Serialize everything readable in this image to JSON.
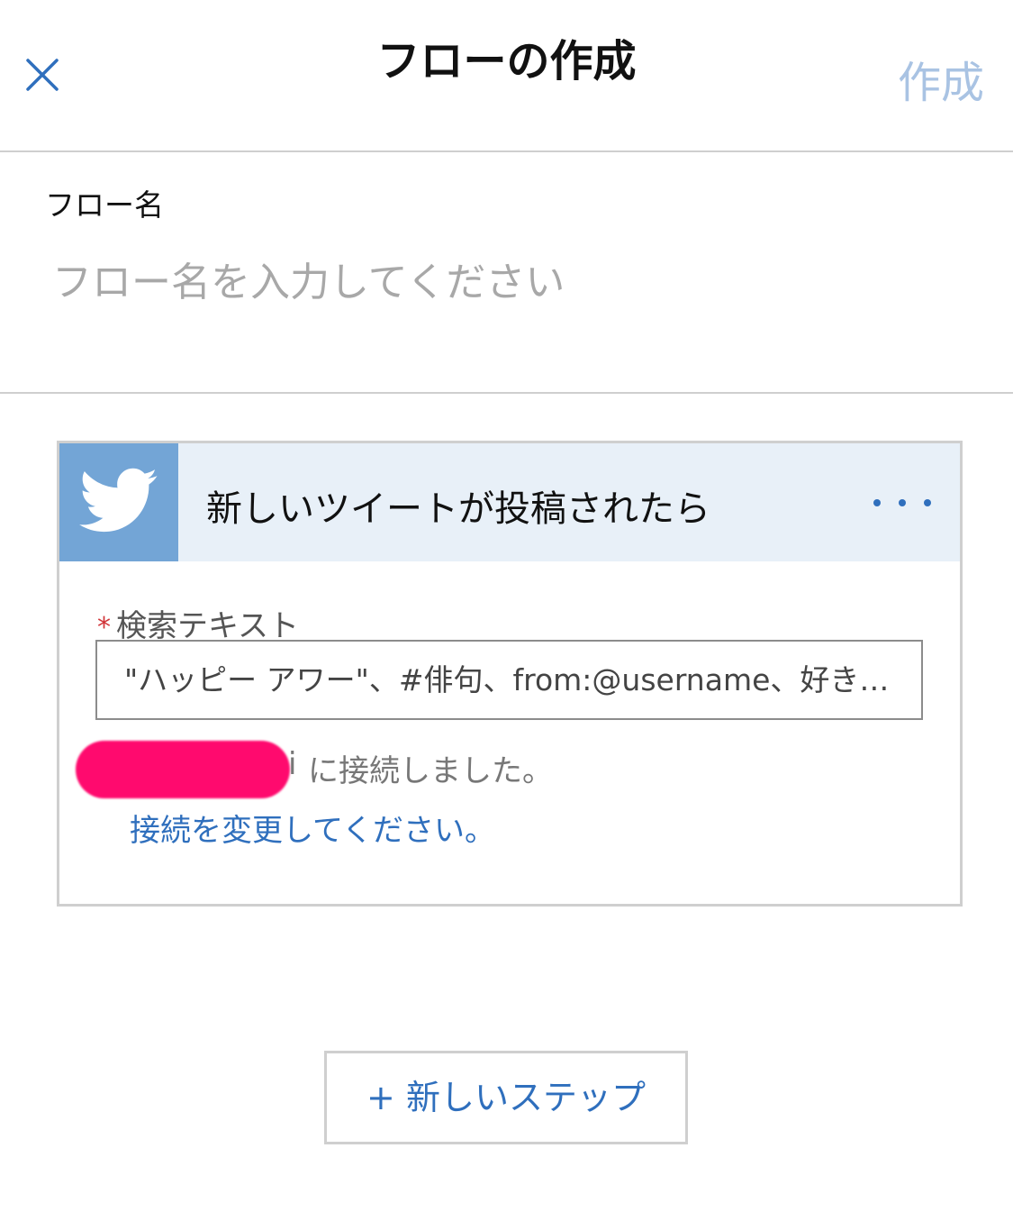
{
  "header": {
    "title": "フローの作成",
    "create_label": "作成"
  },
  "flow_name": {
    "label": "フロー名",
    "placeholder": "フロー名を入力してください"
  },
  "trigger": {
    "icon": "twitter-icon",
    "title": "新しいツイートが投稿されたら",
    "search_label": "検索テキスト",
    "required_mark": "*",
    "search_placeholder": "\"ハッピー アワー\"、#俳句、from:@username、好き…",
    "connection_suffix": "i",
    "connection_text": "に接続しました。",
    "change_connection": "接続を変更してください。"
  },
  "new_step_label": "+ 新しいステップ",
  "colors": {
    "accent": "#2f6fbd",
    "create_disabled": "#a9c3e3",
    "twitter_tile": "#73a5d6",
    "card_header": "#e8f0f8",
    "redaction": "#ff0a6e",
    "required": "#d13438"
  }
}
